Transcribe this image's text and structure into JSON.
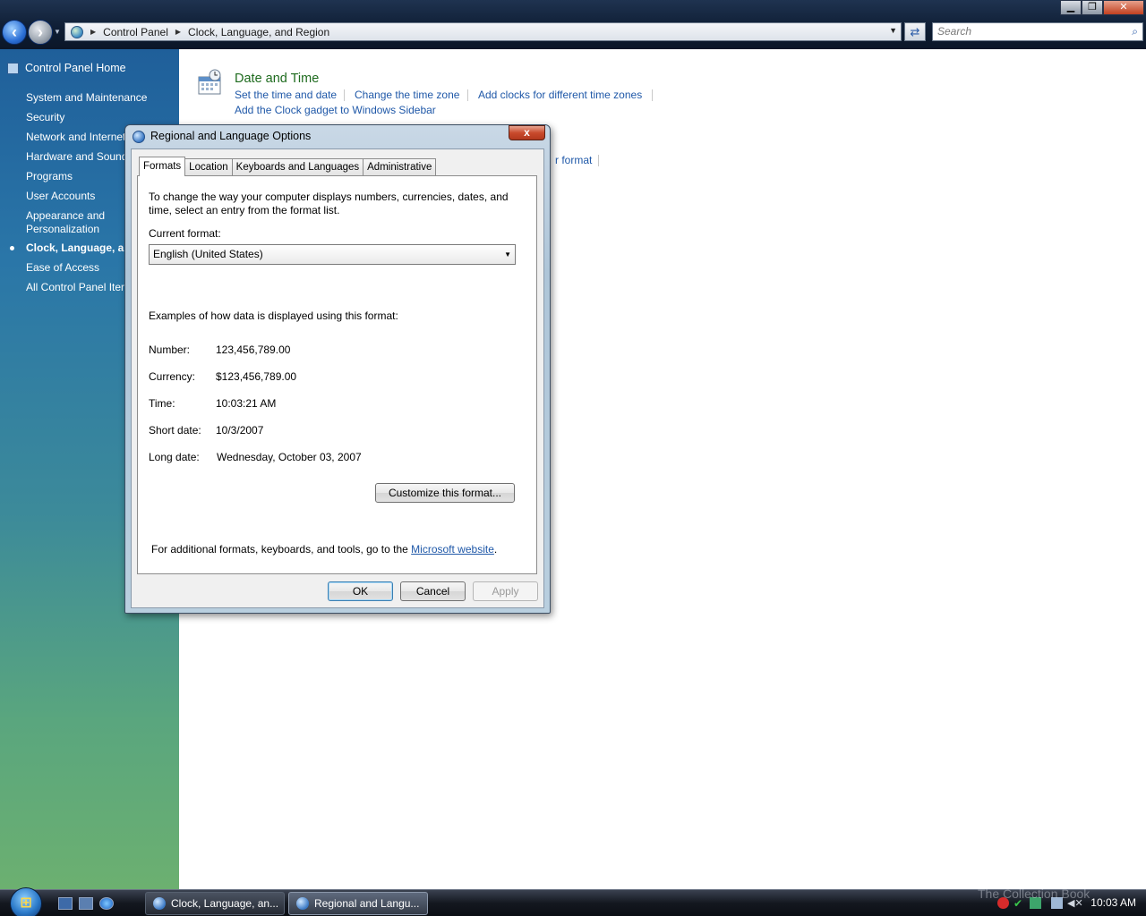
{
  "window": {
    "minimize_label": "▁",
    "restore_label": "❐",
    "close_label": "✕"
  },
  "address_bar": {
    "crumbs": [
      "Control Panel",
      "Clock, Language, and Region"
    ],
    "search_placeholder": "Search"
  },
  "left_nav": {
    "home": "Control Panel Home",
    "items": [
      "System and Maintenance",
      "Security",
      "Network and Internet",
      "Hardware and Sound",
      "Programs",
      "User Accounts",
      "Appearance and\nPersonalization",
      "Clock, Language, and Region",
      "Ease of Access",
      "All Control Panel Items"
    ],
    "selected": "Clock, Language, and Region"
  },
  "main": {
    "category_title": "Date and Time",
    "links_row1": [
      "Set the time and date",
      "Change the time zone",
      "Add clocks for different time zones"
    ],
    "links_row2": [
      "Add the Clock gadget to Windows Sidebar"
    ],
    "partial_link": "r format"
  },
  "dialog": {
    "title": "Regional and Language Options",
    "close_label": "x",
    "tabs": [
      "Formats",
      "Location",
      "Keyboards and Languages",
      "Administrative"
    ],
    "active_tab": "Formats",
    "intro_line1": "To change the way your computer displays numbers, currencies, dates, and",
    "intro_line2": "time, select an entry from the format list.",
    "current_format_label": "Current format:",
    "current_format_value": "English (United States)",
    "examples_heading": "Examples of how data is displayed using this format:",
    "examples": [
      {
        "label": "Number:",
        "value": "123,456,789.00"
      },
      {
        "label": "Currency:",
        "value": "$123,456,789.00"
      },
      {
        "label": "Time:",
        "value": "10:03:21 AM"
      },
      {
        "label": "Short date:",
        "value": "10/3/2007"
      },
      {
        "label": "Long date:",
        "value": "Wednesday, October 03, 2007"
      }
    ],
    "customize_button": "Customize this format...",
    "footer_text": "For additional formats, keyboards, and tools, go to the ",
    "footer_link": "Microsoft website",
    "footer_end": ".",
    "ok": "OK",
    "cancel": "Cancel",
    "apply": "Apply"
  },
  "taskbar": {
    "buttons": [
      "Clock, Language, an...",
      "Regional and Langu..."
    ],
    "active_button": "Regional and Langu...",
    "clock": "10:03 AM",
    "watermark": "The Collection Book"
  },
  "colors": {
    "link": "#1f58a8",
    "category_title": "#1e6b1e"
  }
}
